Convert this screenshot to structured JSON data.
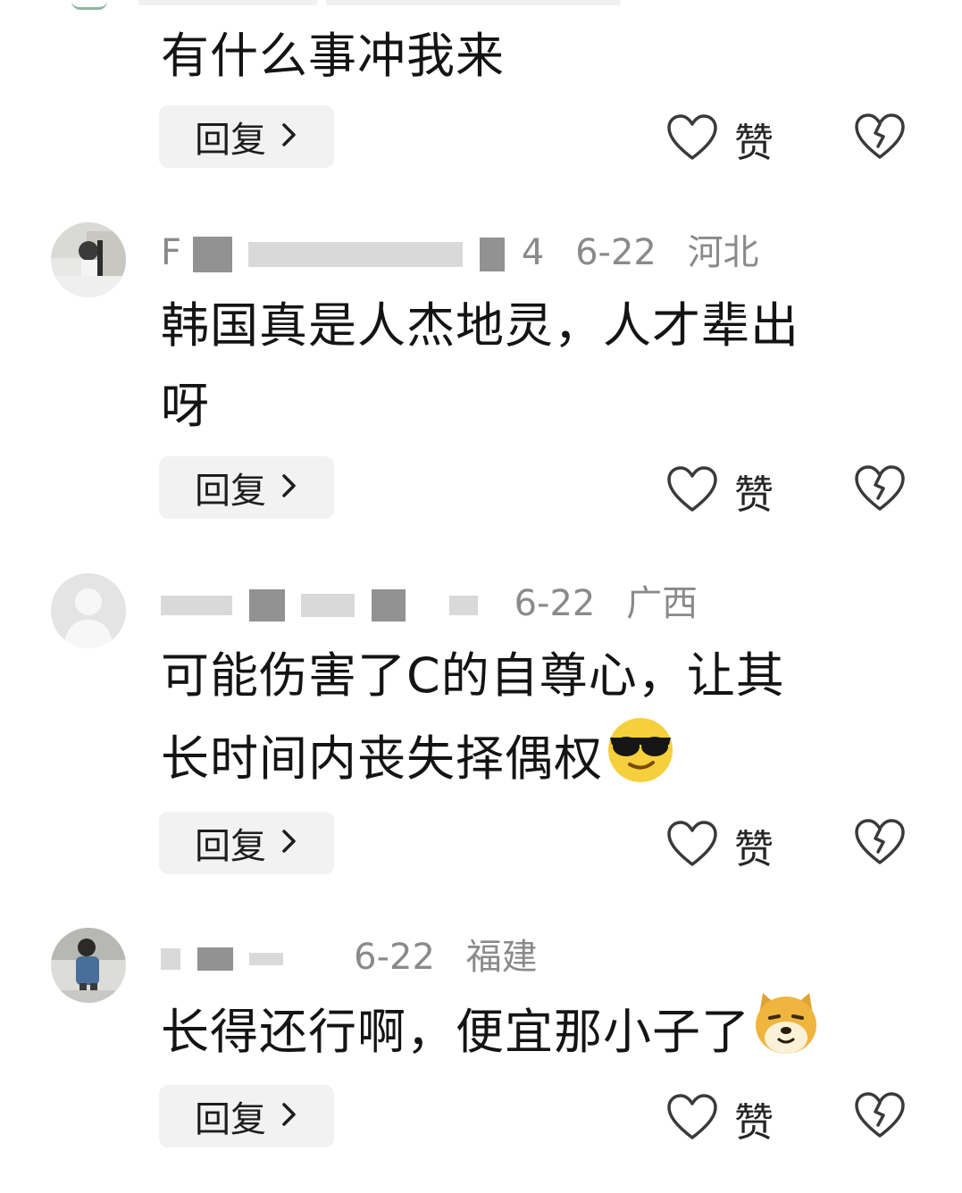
{
  "comments": [
    {
      "text_lines": [
        "有什么事冲我来"
      ],
      "reply_label": "回复",
      "like_label": "赞"
    },
    {
      "user_visible": "F",
      "user_tail": "4",
      "date": "6-22",
      "location": "河北",
      "text_lines": [
        "韩国真是人杰地灵，人才辈出",
        "呀"
      ],
      "reply_label": "回复",
      "like_label": "赞"
    },
    {
      "date": "6-22",
      "location": "广西",
      "text_lines": [
        "可能伤害了C的自尊心，让其",
        "长时间内丧失择偶权"
      ],
      "emoji": "sunglasses-emoji",
      "reply_label": "回复",
      "like_label": "赞"
    },
    {
      "date": "6-22",
      "location": "福建",
      "text_lines": [
        "长得还行啊，便宜那小子了"
      ],
      "emoji": "doge-emoji",
      "reply_label": "回复",
      "like_label": "赞"
    }
  ],
  "icons": {
    "like": "heart-outline-icon",
    "dislike": "broken-heart-icon",
    "reply_chevron": "chevron-right-icon"
  },
  "colors": {
    "meta_gray": "#8a8a8a",
    "reply_bg": "#f2f2f2",
    "icon_stroke": "#3a3a3a"
  }
}
